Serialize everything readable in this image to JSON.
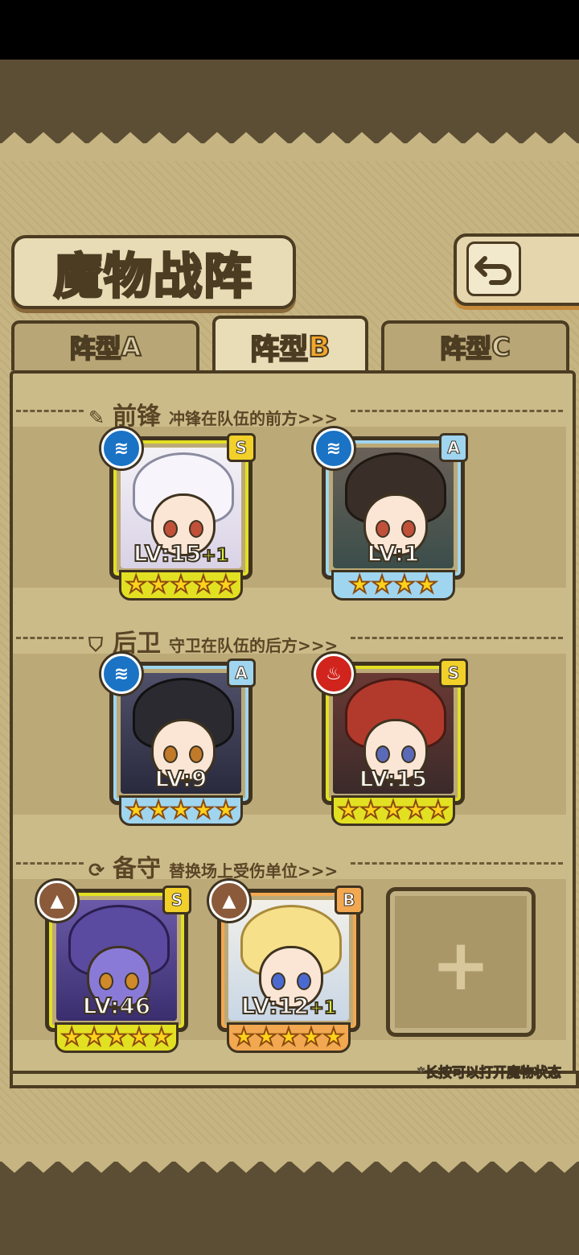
{
  "title": "魔物战阵",
  "back_button": {
    "icon": "back-arrow-icon"
  },
  "tabs": [
    {
      "label": "阵型",
      "suffix": "A",
      "active": false
    },
    {
      "label": "阵型",
      "suffix": "B",
      "active": true
    },
    {
      "label": "阵型",
      "suffix": "C",
      "active": false
    }
  ],
  "sections": {
    "front": {
      "icon": "sword-icon",
      "title": "前锋",
      "desc": "冲锋在队伍的前方>>>"
    },
    "back": {
      "icon": "shield-icon",
      "title": "后卫",
      "desc": "守卫在队伍的后方>>>"
    },
    "reserve": {
      "icon": "swap-icon",
      "title": "备守",
      "desc": "替换场上受伤单位>>>"
    }
  },
  "cards": {
    "front1": {
      "element": "water",
      "rank": "S",
      "level": "LV:15",
      "bonus": "+1",
      "stars": 5,
      "frame_color": "#e2e022"
    },
    "front2": {
      "element": "water",
      "rank": "A",
      "level": "LV:1",
      "bonus": "",
      "stars": 4,
      "frame_color": "#9fd5ef"
    },
    "back1": {
      "element": "water",
      "rank": "A",
      "level": "LV:9",
      "bonus": "",
      "stars": 5,
      "frame_color": "#9fd5ef"
    },
    "back2": {
      "element": "fire",
      "rank": "S",
      "level": "LV:15",
      "bonus": "",
      "stars": 5,
      "frame_color": "#e2e022"
    },
    "res1": {
      "element": "earth",
      "rank": "S",
      "level": "LV:46",
      "bonus": "",
      "stars": 5,
      "frame_color": "#e2e022"
    },
    "res2": {
      "element": "earth",
      "rank": "B",
      "level": "LV:12",
      "bonus": "+1",
      "stars": 5,
      "frame_color": "#f2a850"
    }
  },
  "empty_slot": {
    "icon": "plus-icon",
    "glyph": "+"
  },
  "footnote": "*长按可以打开魔物状态",
  "colors": {
    "accent": "#f2a62c",
    "panel": "#cbbb88",
    "border": "#4b3c22"
  }
}
